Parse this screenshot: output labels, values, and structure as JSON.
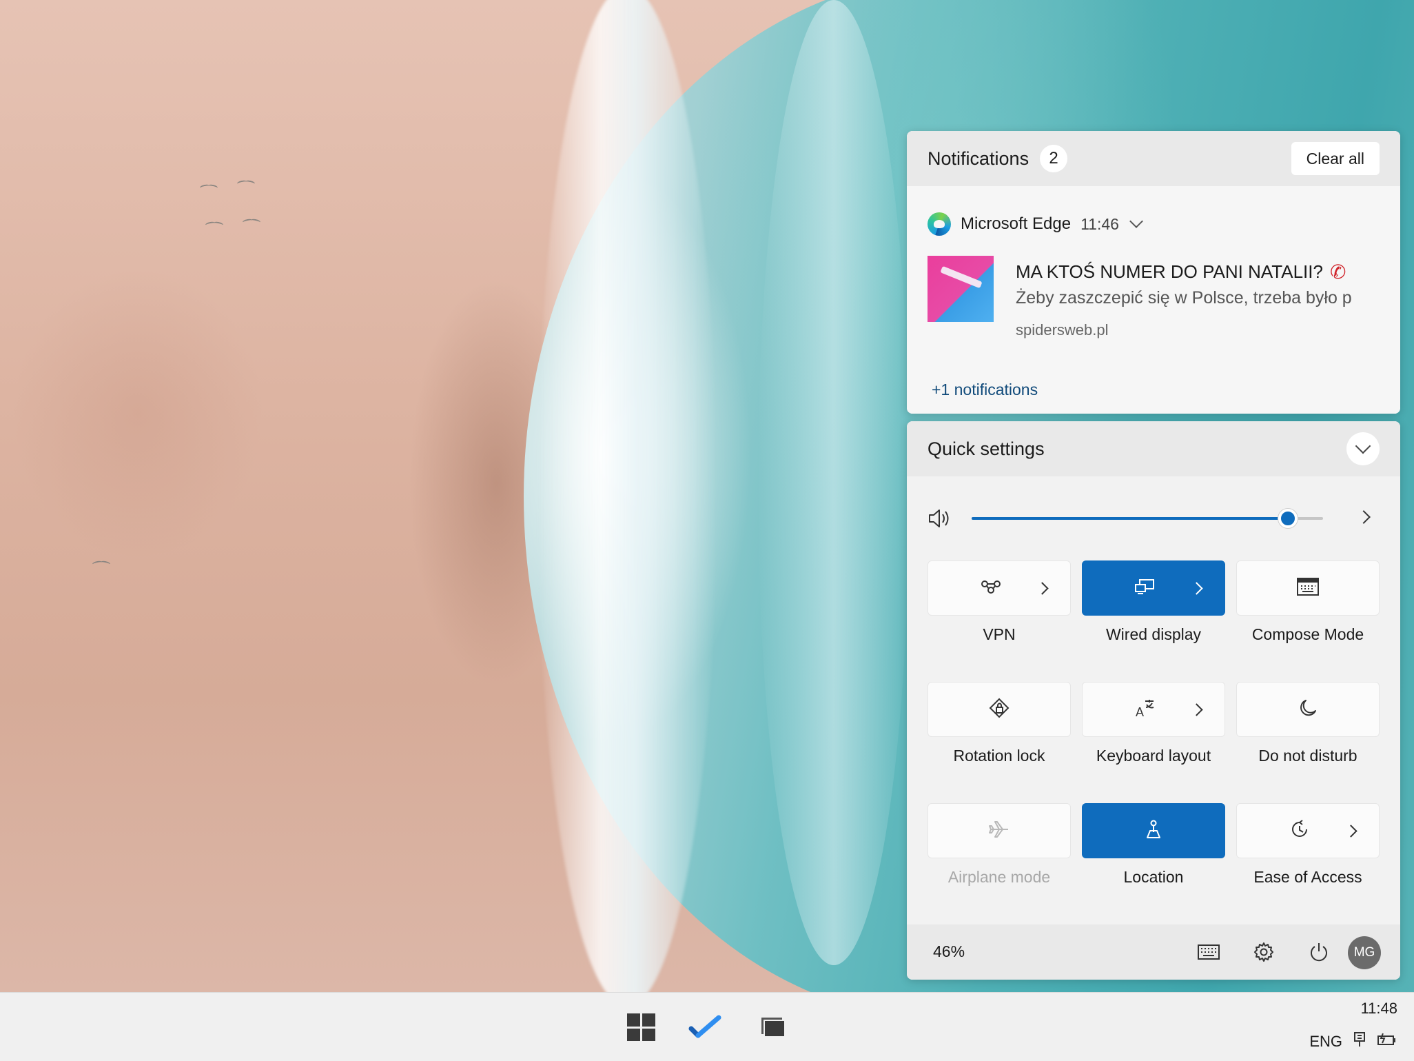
{
  "notifications": {
    "title": "Notifications",
    "count": "2",
    "clear_all_label": "Clear all",
    "items": [
      {
        "app_name": "Microsoft Edge",
        "time": "11:46",
        "title": "MA KTOŚ NUMER DO PANI NATALII?",
        "title_icon": "phone-icon",
        "body": "Żeby zaszczepić się w Polsce, trzeba było p",
        "source": "spidersweb.pl"
      }
    ],
    "more_label": "+1 notifications"
  },
  "quick_settings": {
    "title": "Quick settings",
    "volume_level": 0.9,
    "tiles": [
      {
        "label": "VPN",
        "icon": "vpn-icon",
        "active": false,
        "has_chevron": true,
        "disabled": false
      },
      {
        "label": "Wired display",
        "icon": "wired-display-icon",
        "active": true,
        "has_chevron": true,
        "disabled": false
      },
      {
        "label": "Compose Mode",
        "icon": "keyboard-icon",
        "active": false,
        "has_chevron": false,
        "disabled": false
      },
      {
        "label": "Rotation lock",
        "icon": "rotation-lock-icon",
        "active": false,
        "has_chevron": false,
        "disabled": false
      },
      {
        "label": "Keyboard layout",
        "icon": "keyboard-layout-icon",
        "active": false,
        "has_chevron": true,
        "disabled": false
      },
      {
        "label": "Do not disturb",
        "icon": "moon-icon",
        "active": false,
        "has_chevron": false,
        "disabled": false
      },
      {
        "label": "Airplane mode",
        "icon": "airplane-icon",
        "active": false,
        "has_chevron": false,
        "disabled": true
      },
      {
        "label": "Location",
        "icon": "location-icon",
        "active": true,
        "has_chevron": false,
        "disabled": false
      },
      {
        "label": "Ease of Access",
        "icon": "ease-of-access-icon",
        "active": false,
        "has_chevron": true,
        "disabled": false
      }
    ],
    "battery": "46%"
  },
  "taskbar": {
    "time": "11:48",
    "language": "ENG"
  },
  "user": {
    "initials": "MG"
  },
  "colors": {
    "accent": "#0f6cbd"
  }
}
